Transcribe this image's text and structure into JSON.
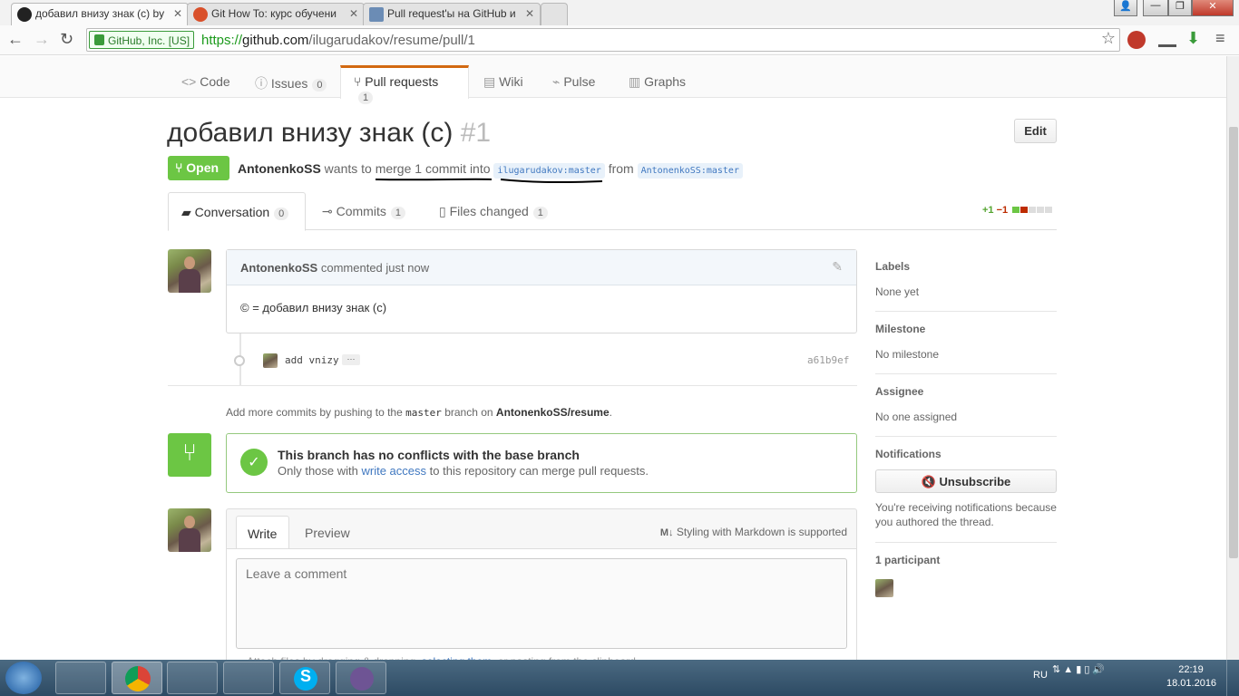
{
  "browser": {
    "tabs": [
      {
        "title": "добавил внизу знак (с) by",
        "icon": "github-icon",
        "active": true
      },
      {
        "title": "Git How To: курс обучени",
        "icon": "githowto-icon"
      },
      {
        "title": "Pull request'ы на GitHub и",
        "icon": "habr-icon"
      }
    ],
    "ev_label": "GitHub, Inc. [US]",
    "url_scheme": "https://",
    "url_host": "github.com",
    "url_path": "/ilugarudakov/resume/pull/1"
  },
  "repo_nav": [
    {
      "label": "Code",
      "icon": "code-icon"
    },
    {
      "label": "Issues",
      "count": "0",
      "icon": "issue-icon"
    },
    {
      "label": "Pull requests",
      "count": "1",
      "icon": "pr-icon",
      "selected": true
    },
    {
      "label": "Wiki",
      "icon": "book-icon"
    },
    {
      "label": "Pulse",
      "icon": "pulse-icon"
    },
    {
      "label": "Graphs",
      "icon": "graph-icon"
    }
  ],
  "pr": {
    "title": "добавил внизу знак (с)",
    "number": "#1",
    "edit_label": "Edit",
    "state": "Open",
    "author": "AntonenkoSS",
    "wants_text": "wants to merge 1 commit into",
    "base_ref": "ilugarudakov:master",
    "from_text": "from",
    "head_ref": "AntonenkoSS:master",
    "tabs": [
      {
        "label": "Conversation",
        "count": "0"
      },
      {
        "label": "Commits",
        "count": "1"
      },
      {
        "label": "Files changed",
        "count": "1"
      }
    ],
    "diffstat_add": "+1",
    "diffstat_del": "−1"
  },
  "comment": {
    "author": "AntonenkoSS",
    "action": "commented",
    "time": "just now",
    "body": "© = добавил внизу знак (с)"
  },
  "commit": {
    "message": "add vnizy",
    "ellipsis": "···",
    "sha": "a61b9ef"
  },
  "push_hint": {
    "prefix": "Add more commits by pushing to the",
    "branch": "master",
    "middle": "branch on",
    "repo": "AntonenkoSS/resume",
    "suffix": "."
  },
  "merge": {
    "title": "This branch has no conflicts with the base branch",
    "desc_prefix": "Only those with",
    "desc_link": "write access",
    "desc_suffix": "to this repository can merge pull requests."
  },
  "composer": {
    "write_tab": "Write",
    "preview_tab": "Preview",
    "markdown_hint": "Styling with Markdown is supported",
    "placeholder": "Leave a comment",
    "attach_prefix": "Attach files by dragging & dropping,",
    "attach_link": "selecting them",
    "attach_suffix": ", or pasting from the clipboard."
  },
  "sidebar": {
    "labels_title": "Labels",
    "labels_value": "None yet",
    "milestone_title": "Milestone",
    "milestone_value": "No milestone",
    "assignee_title": "Assignee",
    "assignee_value": "No one assigned",
    "notifications_title": "Notifications",
    "unsubscribe_label": "Unsubscribe",
    "notifications_reason": "You're receiving notifications because you authored the thread.",
    "participants_title": "1 participant"
  },
  "taskbar": {
    "lang": "RU",
    "time": "22:19",
    "date": "18.01.2016"
  },
  "colors": {
    "accent": "#4078c0",
    "open": "#6cc644",
    "tab_active": "#d26911"
  }
}
